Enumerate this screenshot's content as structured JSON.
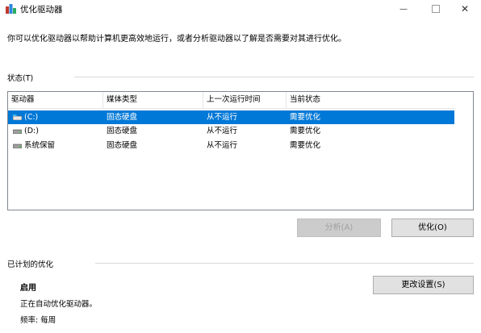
{
  "window": {
    "title": "优化驱动器",
    "minimize_glyph": "—",
    "close_glyph": "✕"
  },
  "description": "你可以优化驱动器以帮助计算机更高效地运行，或者分析驱动器以了解是否需要对其进行优化。",
  "status_section": {
    "label": "状态(T)",
    "columns": [
      "驱动器",
      "媒体类型",
      "上一次运行时间",
      "当前状态"
    ],
    "rows": [
      {
        "drive": "(C:)",
        "media": "固态硬盘",
        "last_run": "从不运行",
        "status": "需要优化",
        "icon": "windows-drive-icon",
        "selected": true
      },
      {
        "drive": "(D:)",
        "media": "固态硬盘",
        "last_run": "从不运行",
        "status": "需要优化",
        "icon": "drive-icon",
        "selected": false
      },
      {
        "drive": "系统保留",
        "media": "固态硬盘",
        "last_run": "从不运行",
        "status": "需要优化",
        "icon": "drive-icon",
        "selected": false
      }
    ]
  },
  "buttons": {
    "analyze": "分析(A)",
    "optimize": "优化(O)",
    "change_settings": "更改设置(S)"
  },
  "scheduled": {
    "label": "已计划的优化",
    "state": "启用",
    "line1": "正在自动优化驱动器。",
    "frequency": "频率: 每周"
  },
  "colors": {
    "selection": "#0078d7"
  }
}
